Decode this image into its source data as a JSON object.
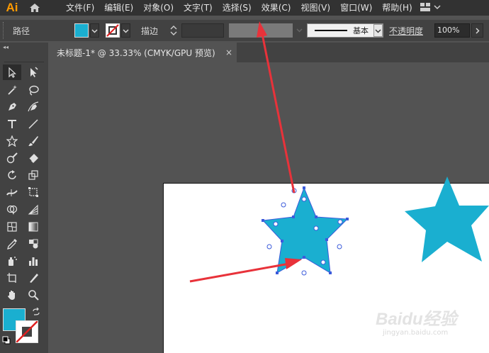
{
  "app": {
    "logo": "Ai"
  },
  "menu": {
    "items": [
      "文件(F)",
      "编辑(E)",
      "对象(O)",
      "文字(T)",
      "选择(S)",
      "效果(C)",
      "视图(V)",
      "窗口(W)",
      "帮助(H)"
    ]
  },
  "control": {
    "selection_label": "路径",
    "stroke_label": "描边",
    "stroke_value": "",
    "brush_label": "基本",
    "opacity_label": "不透明度",
    "opacity_value": "100%"
  },
  "document": {
    "tab_title": "未标题-1* @ 33.33% (CMYK/GPU 预览)",
    "close_glyph": "×"
  },
  "colors": {
    "fill": "#1aafd0",
    "stroke": "none",
    "star_fill": "#1aafd0",
    "selection": "#3b5bdb",
    "annotation_arrow": "#e8323a"
  },
  "icons": [
    "home-icon",
    "workspace-icon",
    "selection-tool-icon",
    "direct-selection-tool-icon",
    "magic-wand-icon",
    "lasso-icon",
    "pen-icon",
    "curvature-icon",
    "type-icon",
    "line-icon",
    "star-icon",
    "paintbrush-icon",
    "shaper-icon",
    "eraser-icon",
    "rotate-icon",
    "scale-icon",
    "width-icon",
    "free-transform-icon",
    "shape-builder-icon",
    "perspective-icon",
    "mesh-icon",
    "gradient-icon",
    "eyedropper-icon",
    "blend-icon",
    "symbol-sprayer-icon",
    "column-graph-icon",
    "artboard-icon",
    "slice-icon",
    "hand-icon",
    "zoom-icon"
  ],
  "watermark": {
    "brand": "Baidu经验",
    "site": "jingyan.baidu.com"
  }
}
